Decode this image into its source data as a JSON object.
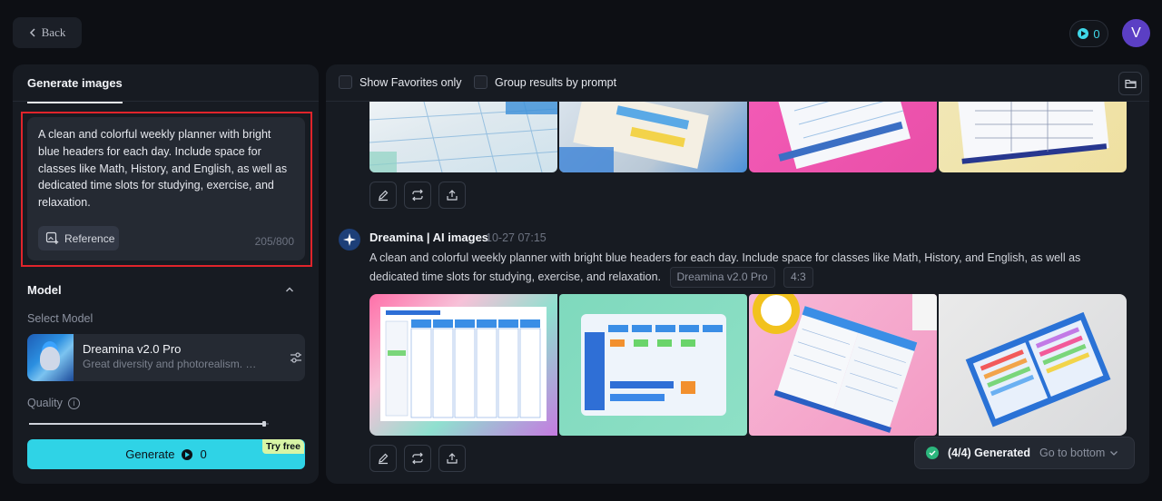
{
  "topbar": {
    "back_label": "Back",
    "credits": "0",
    "avatar_initial": "V"
  },
  "left_panel": {
    "tab_label": "Generate images",
    "prompt_text": "A clean and colorful weekly planner with bright blue headers for each day. Include space for classes like Math, History, and English, as well as dedicated time slots for studying, exercise, and relaxation.",
    "reference_label": "Reference",
    "char_count": "205/800",
    "model_section_label": "Model",
    "select_model_label": "Select Model",
    "model_name": "Dreamina v2.0 Pro",
    "model_desc": "Great diversity and photorealism. Of...",
    "quality_label": "Quality",
    "quality_level": 0.98,
    "generate_label": "Generate",
    "generate_cost": "0",
    "try_free_label": "Try free"
  },
  "right_panel": {
    "show_favorites_label": "Show Favorites only",
    "group_results_label": "Group results by prompt",
    "bot_name": "Dreamina | AI images",
    "bot_date": "10-27  07:15",
    "prompt_text": "A clean and colorful weekly planner with bright blue headers for each day. Include space for classes like Math, History, and English, as well as dedicated time slots for studying, exercise, and relaxation.",
    "model_tag": "Dreamina v2.0 Pro",
    "ratio_tag": "4:3",
    "generated_status": "(4/4) Generated",
    "go_to_bottom_label": "Go to bottom"
  },
  "icons": [
    "chevron-left-icon",
    "play-coin-icon",
    "image-add-icon",
    "chevron-up-icon",
    "sliders-icon",
    "info-icon",
    "folder-icon",
    "edit-icon",
    "regenerate-icon",
    "upload-icon",
    "dreamina-star-icon",
    "check-icon",
    "chevron-down-icon"
  ],
  "colors": {
    "accent": "#2fd3e6",
    "highlight_outline": "#e0242b",
    "success": "#2cb67d",
    "avatar": "#5b3fc4"
  }
}
